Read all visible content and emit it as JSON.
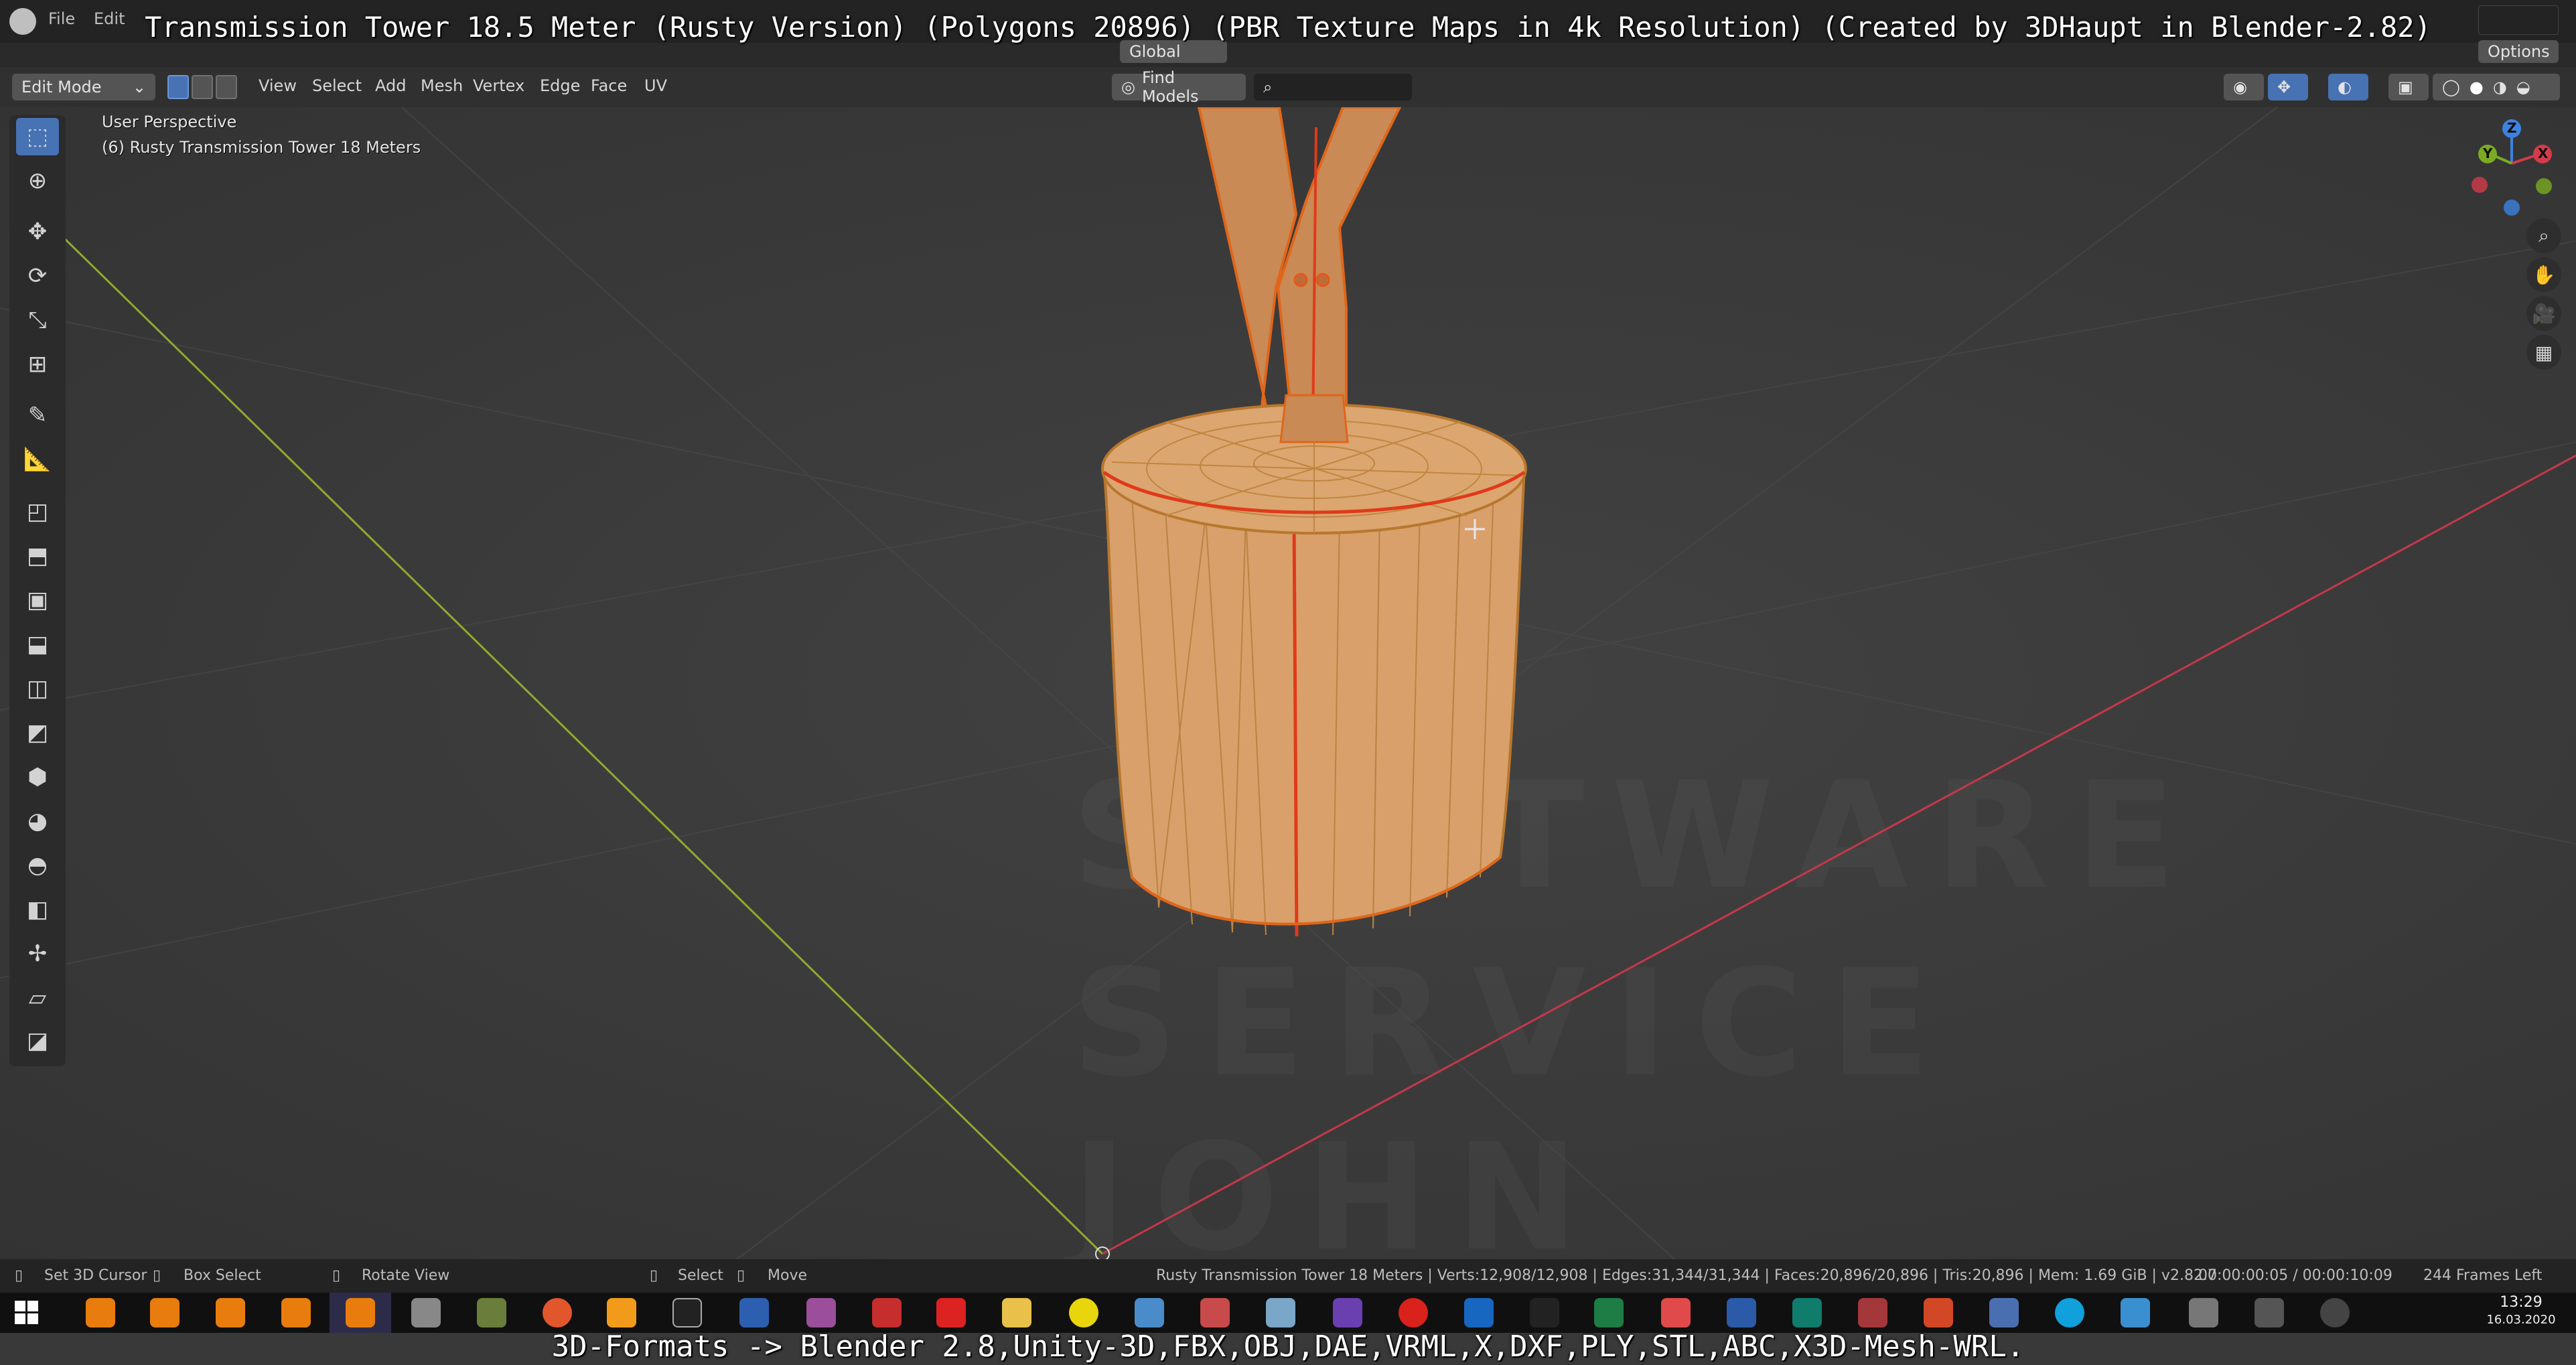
{
  "captions": {
    "top": "Transmission Tower 18.5 Meter (Rusty Version) (Polygons 20896) (PBR Texture Maps in 4k Resolution) (Created by 3DHaupt in Blender-2.82)",
    "bottom": "3D-Formats -> Blender 2.8,Unity-3D,FBX,OBJ,DAE,VRML,X,DXF,PLY,STL,ABC,X3D-Mesh-WRL."
  },
  "topbar": {
    "menu": [
      "File",
      "Edit"
    ]
  },
  "header": {
    "mode": "Edit Mode",
    "menu": [
      "View",
      "Select",
      "Add",
      "Mesh",
      "Vertex",
      "Edge",
      "Face",
      "UV"
    ],
    "orientation": "Global",
    "find_models": "Find Models",
    "options": "Options"
  },
  "viewport": {
    "view_name": "User Perspective",
    "object_name": "(6) Rusty Transmission Tower 18 Meters",
    "watermark": [
      "SOFTWARE",
      "SERVICE",
      "JOHN"
    ]
  },
  "gizmo": {
    "x": "X",
    "y": "Y",
    "z": "Z"
  },
  "status": {
    "set_cursor": "Set 3D Cursor",
    "box_select": "Box Select",
    "rotate_view": "Rotate View",
    "select": "Select",
    "move": "Move",
    "stats": "Rusty Transmission Tower 18 Meters | Verts:12,908/12,908 | Edges:31,344/31,344 | Faces:20,896/20,896 | Tris:20,896 | Mem: 1.69 GiB | v2.82.7",
    "timer": "00:00:00:05 / 00:00:10:09",
    "frames_left": "244 Frames Left"
  },
  "taskbar": {
    "time": "13:29",
    "date": "16.03.2020"
  },
  "colors": {
    "model": "#d9a06b",
    "wire": "#ff7a00",
    "selected_edge": "#e03a1a",
    "y_axis": "#8faa2e",
    "x_axis": "#c4384a",
    "accent": "#4772b3"
  }
}
